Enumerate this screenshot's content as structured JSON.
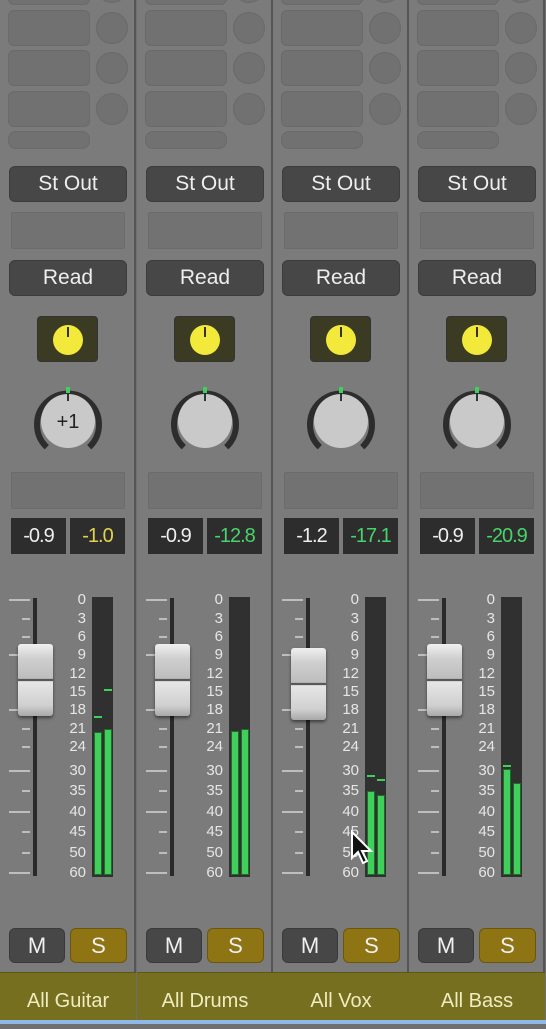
{
  "scale_labels": [
    "0",
    "3",
    "6",
    "9",
    "12",
    "15",
    "18",
    "21",
    "24",
    "30",
    "35",
    "40",
    "45",
    "50",
    "60"
  ],
  "colors": {
    "meter": "#3fcf5a",
    "solo": "#8f7414",
    "name_band": "#756f1f",
    "volume_knob": "#f2e93b",
    "peak_yellow": "#e3d34a",
    "peak_green": "#47d46a"
  },
  "strips": [
    {
      "name": "All Guitar",
      "output": "St Out",
      "automation": "Read",
      "pan_label": "+1",
      "volume": "-0.9",
      "peak": "-1.0",
      "peak_color": "yellow",
      "mute": "M",
      "solo": "S",
      "solo_active": true,
      "meter_db": [
        21.5,
        21
      ],
      "meter_hold_db": [
        19,
        14.5
      ]
    },
    {
      "name": "All Drums",
      "output": "St Out",
      "automation": "Read",
      "pan_label": "",
      "volume": "-0.9",
      "peak": "-12.8",
      "peak_color": "green",
      "mute": "M",
      "solo": "S",
      "solo_active": true,
      "meter_db": [
        21.3,
        21
      ],
      "meter_hold_db": [
        null,
        null
      ]
    },
    {
      "name": "All Vox",
      "output": "St Out",
      "automation": "Read",
      "pan_label": "",
      "volume": "-1.2",
      "peak": "-17.1",
      "peak_color": "green",
      "mute": "M",
      "solo": "S",
      "solo_active": true,
      "meter_db": [
        35,
        36
      ],
      "meter_hold_db": [
        31,
        32
      ]
    },
    {
      "name": "All Bass",
      "output": "St Out",
      "automation": "Read",
      "pan_label": "",
      "volume": "-0.9",
      "peak": "-20.9",
      "peak_color": "green",
      "mute": "M",
      "solo": "S",
      "solo_active": true,
      "meter_db": [
        29.5,
        33
      ],
      "meter_hold_db": [
        28.5,
        null
      ]
    }
  ]
}
